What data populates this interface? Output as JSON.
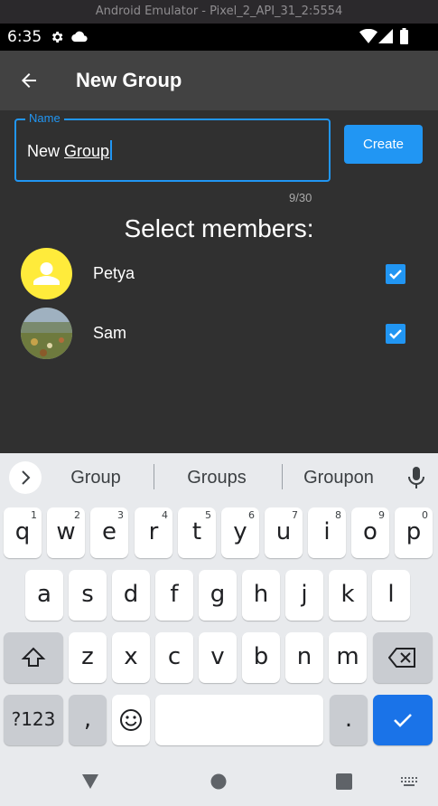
{
  "emulator": {
    "title": "Android Emulator - Pixel_2_API_31_2:5554"
  },
  "status_bar": {
    "time": "6:35",
    "icons": [
      "gear-icon",
      "cloud-icon",
      "wifi-icon",
      "signal-icon",
      "battery-icon"
    ]
  },
  "app_bar": {
    "title": "New Group",
    "back_icon": "arrow-left-icon"
  },
  "name_field": {
    "label": "Name",
    "value_prefix": "New ",
    "value_underlined": "Group",
    "counter": "9/30"
  },
  "create_button": {
    "label": "Create"
  },
  "members": {
    "heading": "Select members:",
    "items": [
      {
        "name": "Petya",
        "avatar": "default-person",
        "checked": true
      },
      {
        "name": "Sam",
        "avatar": "photo",
        "checked": true
      }
    ]
  },
  "keyboard": {
    "suggestions": [
      "Group",
      "Groups",
      "Groupon"
    ],
    "row1": [
      "q",
      "w",
      "e",
      "r",
      "t",
      "y",
      "u",
      "i",
      "o",
      "p"
    ],
    "row1_hints": [
      "1",
      "2",
      "3",
      "4",
      "5",
      "6",
      "7",
      "8",
      "9",
      "0"
    ],
    "row2": [
      "a",
      "s",
      "d",
      "f",
      "g",
      "h",
      "j",
      "k",
      "l"
    ],
    "row3": [
      "z",
      "x",
      "c",
      "v",
      "b",
      "n",
      "m"
    ],
    "symbols_label": "?123",
    "comma": ",",
    "period": "."
  },
  "colors": {
    "accent": "#2196f3",
    "background": "#303030",
    "appbar": "#424242",
    "avatar_yellow": "#ffeb3b",
    "keyboard_blue": "#1a73e8"
  }
}
